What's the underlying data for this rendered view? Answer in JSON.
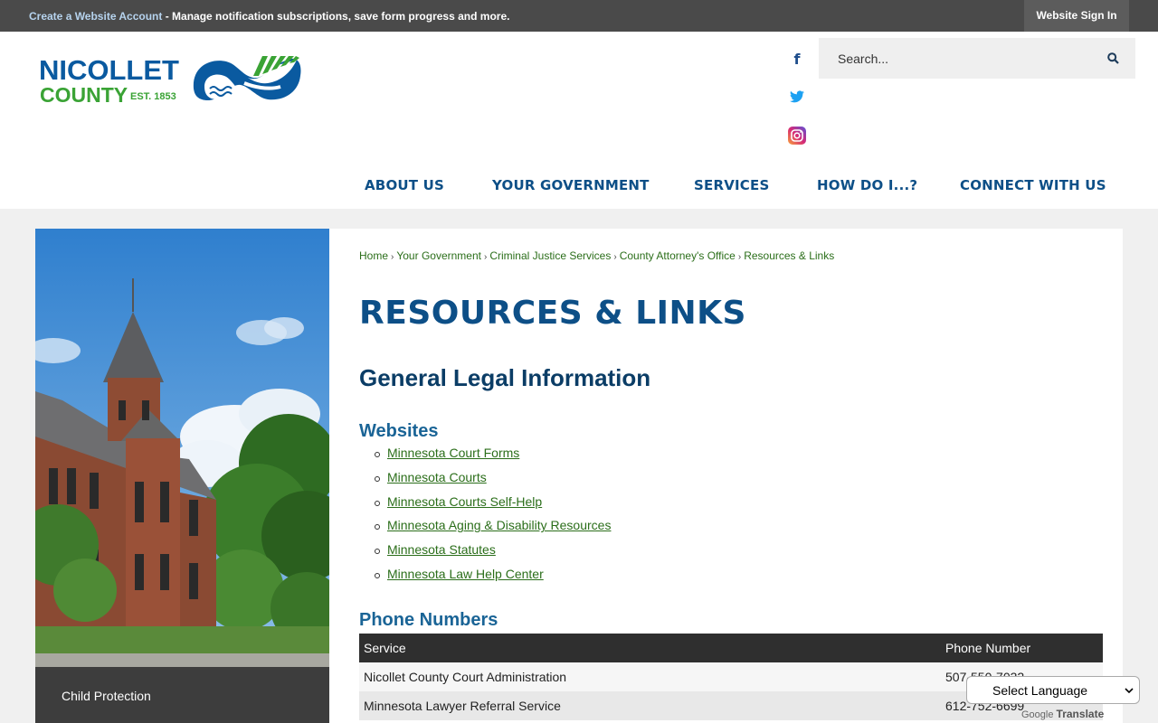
{
  "topbar": {
    "account_link": "Create a Website Account",
    "message": " - Manage notification subscriptions, save form progress and more.",
    "sign_in": "Website Sign In"
  },
  "logo": {
    "line1": "NICOLLET",
    "line2": "COUNTY",
    "est": "EST. 1853"
  },
  "search": {
    "placeholder": "Search..."
  },
  "nav": [
    "ABOUT US",
    "YOUR GOVERNMENT",
    "SERVICES",
    "HOW DO I...?",
    "CONNECT WITH US"
  ],
  "sidebar": {
    "items": [
      "Child Protection"
    ]
  },
  "breadcrumb": [
    "Home",
    "Your Government",
    "Criminal Justice Services",
    "County Attorney's Office",
    "Resources & Links"
  ],
  "page": {
    "title": "RESOURCES & LINKS",
    "section": "General Legal Information",
    "websites_heading": "Websites",
    "phones_heading": "Phone Numbers"
  },
  "websites": [
    "Minnesota Court Forms",
    "Minnesota Courts",
    "Minnesota Courts Self-Help",
    "Minnesota Aging & Disability Resources",
    "Minnesota Statutes",
    "Minnesota Law Help Center"
  ],
  "phone_table": {
    "headers": [
      "Service",
      "Phone Number"
    ],
    "rows": [
      [
        "Nicollet County Court Administration",
        "507-550-7032"
      ],
      [
        "Minnesota Lawyer Referral Service",
        "612-752-6699"
      ]
    ]
  },
  "translate": {
    "label": "Select Language",
    "powered_by": "Google",
    "word": "Translate"
  },
  "colors": {
    "nav": "#0d4f87",
    "link": "#2b6e1a",
    "topbar": "#4a4a4a"
  }
}
